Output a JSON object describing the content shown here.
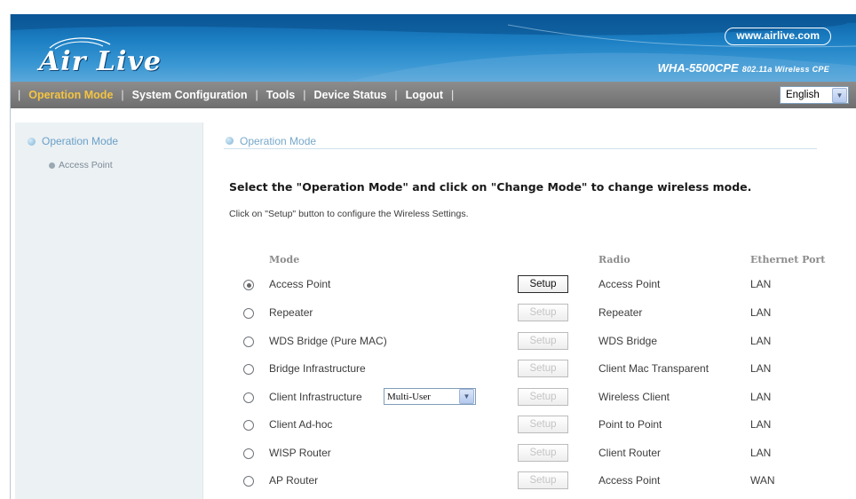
{
  "header": {
    "logo_text": "Air Live",
    "url": "www.airlive.com",
    "model": "WHA-5500CPE",
    "model_sub": "802.11a Wireless CPE"
  },
  "nav": {
    "separator": "|",
    "items": [
      {
        "label": "Operation Mode",
        "active": true
      },
      {
        "label": "System Configuration",
        "active": false
      },
      {
        "label": "Tools",
        "active": false
      },
      {
        "label": "Device Status",
        "active": false
      },
      {
        "label": "Logout",
        "active": false
      }
    ],
    "language": "English"
  },
  "sidebar": {
    "heading": "Operation Mode",
    "items": [
      {
        "label": "Access Point"
      }
    ]
  },
  "main": {
    "section_title": "Operation Mode",
    "instruction": "Select the \"Operation Mode\" and click on \"Change Mode\" to change wireless mode.",
    "sub_instruction": "Click on \"Setup\" button to configure the Wireless Settings.",
    "columns": {
      "mode": "Mode",
      "radio": "Radio",
      "ethernet": "Ethernet Port"
    },
    "setup_label": "Setup",
    "client_infra_option": "Multi-User",
    "modes": [
      {
        "mode": "Access Point",
        "radio": "Access Point",
        "ethernet": "LAN",
        "selected": true,
        "setup_enabled": true
      },
      {
        "mode": "Repeater",
        "radio": "Repeater",
        "ethernet": "LAN",
        "selected": false,
        "setup_enabled": false
      },
      {
        "mode": "WDS Bridge (Pure MAC)",
        "radio": "WDS Bridge",
        "ethernet": "LAN",
        "selected": false,
        "setup_enabled": false
      },
      {
        "mode": "Bridge Infrastructure",
        "radio": "Client Mac Transparent",
        "ethernet": "LAN",
        "selected": false,
        "setup_enabled": false
      },
      {
        "mode": "Client Infrastructure",
        "radio": "Wireless Client",
        "ethernet": "LAN",
        "selected": false,
        "setup_enabled": false
      },
      {
        "mode": "Client Ad-hoc",
        "radio": "Point to Point",
        "ethernet": "LAN",
        "selected": false,
        "setup_enabled": false
      },
      {
        "mode": "WISP Router",
        "radio": "Client Router",
        "ethernet": "LAN",
        "selected": false,
        "setup_enabled": false
      },
      {
        "mode": "AP Router",
        "radio": "Access Point",
        "ethernet": "WAN",
        "selected": false,
        "setup_enabled": false
      }
    ]
  },
  "colors": {
    "header_blue": "#1d80c4",
    "nav_gray": "#7a7a7a",
    "nav_active": "#f5c441",
    "sidebar_bg": "#ecf1f4",
    "section_title": "#77a8cb"
  },
  "icons": [
    "sidebar-bullet-icon",
    "dropdown-arrow-icon",
    "radio-button-icon"
  ]
}
